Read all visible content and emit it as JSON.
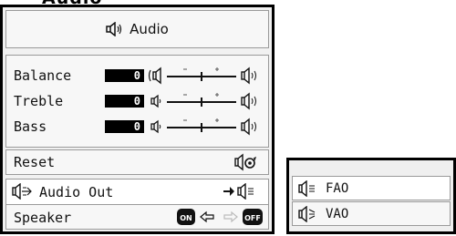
{
  "menu": {
    "title": "Audio",
    "sliders": [
      {
        "label": "Balance",
        "value": "0"
      },
      {
        "label": "Treble",
        "value": "0"
      },
      {
        "label": "Bass",
        "value": "0"
      }
    ],
    "reset_label": "Reset",
    "audio_out_label": "Audio Out",
    "speaker_label": "Speaker",
    "speaker_on": "ON",
    "speaker_off": "OFF",
    "selected": "Audio Out"
  },
  "submenu": {
    "options": [
      {
        "label": "FAO"
      },
      {
        "label": "VAO"
      }
    ],
    "selected": "FAO"
  },
  "icons": {
    "title": "speaker-icon",
    "balance_left": "speaker-left-bracket-icon",
    "balance_right": "speaker-right-icon",
    "treble_left": "speaker-small-icon",
    "treble_right": "speaker-loud-icon",
    "bass_left": "speaker-small-icon",
    "bass_right": "speaker-loud-icon",
    "reset": "speaker-reset-icon",
    "audio_out": "speaker-arrow-icon",
    "audio_out_value": "arrow-speaker-fao-icon",
    "speaker_toggle": "on-off-toggle-icon",
    "fao": "speaker-fao-icon",
    "vao": "speaker-vao-icon"
  },
  "colors": {
    "panel_bg": "#f1f1f1",
    "row_bg": "#f7f7f7",
    "highlight_bg": "#ffffff",
    "border": "#000000",
    "value_box": "#000000"
  }
}
